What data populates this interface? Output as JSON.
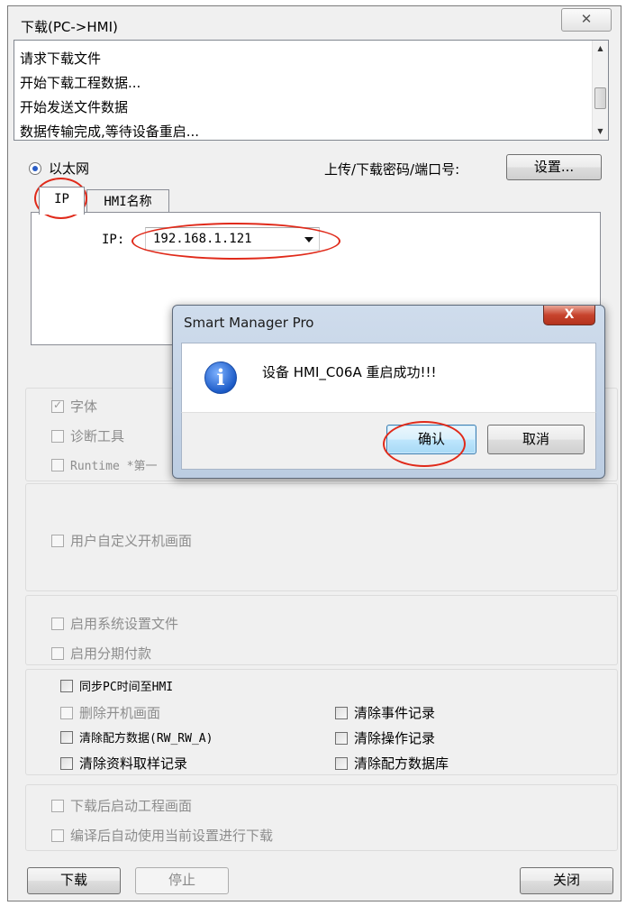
{
  "window": {
    "title": "下载(PC->HMI)",
    "close_glyph": "✕"
  },
  "log": {
    "lines": [
      "请求下载文件",
      "开始下载工程数据...",
      "开始发送文件数据",
      "数据传输完成,等待设备重启..."
    ],
    "scroll_up": "▲",
    "scroll_down": "▼"
  },
  "connection": {
    "ethernet_label": "以太网",
    "password_port_label": "上传/下载密码/端口号:",
    "settings_button": "设置..."
  },
  "tabs": [
    {
      "label": "IP",
      "active": true
    },
    {
      "label": "HMI名称",
      "active": false
    }
  ],
  "ip": {
    "label": "IP:",
    "value": "192.168.1.121"
  },
  "options_group1": [
    {
      "label": "字体",
      "checked": true,
      "enabled": false
    },
    {
      "label": "诊断工具",
      "checked": false,
      "enabled": false
    },
    {
      "label": "Runtime *第一",
      "checked": false,
      "enabled": false
    }
  ],
  "options_group2": {
    "label": "用户自定义开机画面",
    "checked": false,
    "enabled": false
  },
  "options_group3": [
    {
      "label": "启用系统设置文件",
      "checked": false,
      "enabled": false
    },
    {
      "label": "启用分期付款",
      "checked": false,
      "enabled": false
    }
  ],
  "options_group4": {
    "sync_time": {
      "label": "同步PC时间至HMI",
      "checked": false,
      "enabled": true
    },
    "delete_startup": {
      "label": "删除开机画面",
      "checked": false,
      "enabled": false
    },
    "clear_recipe_data": {
      "label": "清除配方数据(RW_RW_A)",
      "checked": false,
      "enabled": true
    },
    "clear_sampling": {
      "label": "清除资料取样记录",
      "checked": false,
      "enabled": true
    },
    "clear_event": {
      "label": "清除事件记录",
      "checked": false,
      "enabled": true
    },
    "clear_operation": {
      "label": "清除操作记录",
      "checked": false,
      "enabled": true
    },
    "clear_recipe_db": {
      "label": "清除配方数据库",
      "checked": false,
      "enabled": true
    }
  },
  "options_group5": [
    {
      "label": "下载后启动工程画面",
      "checked": false,
      "enabled": false
    },
    {
      "label": "编译后自动使用当前设置进行下载",
      "checked": false,
      "enabled": false
    }
  ],
  "buttons": {
    "download": "下载",
    "stop": "停止",
    "close": "关闭"
  },
  "dialog": {
    "title": "Smart Manager Pro",
    "close_glyph": "X",
    "icon": "info-icon",
    "icon_glyph": "i",
    "message": "设备 HMI_C06A 重启成功!!!",
    "ok": "确认",
    "cancel": "取消"
  },
  "colors": {
    "annotation_red": "#e02a1a",
    "dialog_frame": "#bccde2",
    "info_blue": "#1c5bc7"
  }
}
